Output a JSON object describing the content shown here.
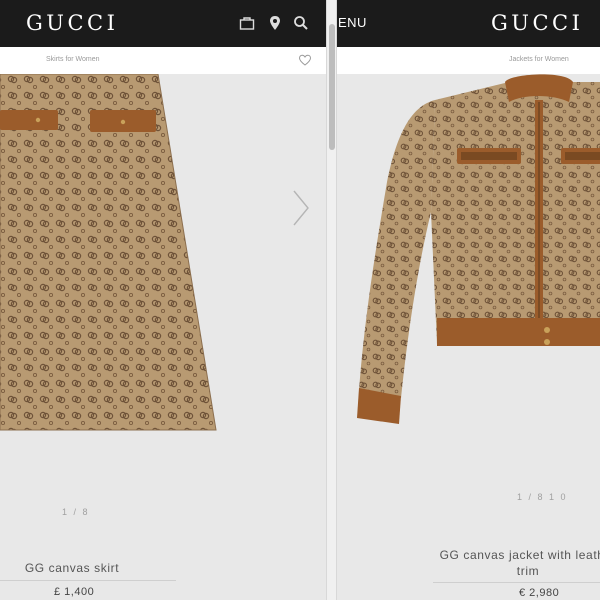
{
  "left_window": {
    "header": {
      "logo": "GUCCI",
      "icons": [
        "shopping-bag-icon",
        "location-pin-icon",
        "search-icon"
      ]
    },
    "breadcrumb": "Skirts for Women",
    "product": {
      "image": "gg-canvas-skirt-image",
      "pager": "1 / 8",
      "name": "GG canvas skirt",
      "price": "£ 1,400"
    }
  },
  "right_window": {
    "header": {
      "menu_label": "ENU",
      "logo": "GUCCI"
    },
    "breadcrumb": "Jackets for Women",
    "product": {
      "image": "gg-canvas-jacket-image",
      "pager": "1 / 8 1 0",
      "name": "GG canvas jacket with leather trim",
      "price": "€ 2,980"
    }
  },
  "colors": {
    "header_bg": "#1b1b1b",
    "page_bg": "#e8e8e8",
    "canvas_beige": "#b89a72",
    "gg_pattern": "#6e5238",
    "leather_trim": "#9b5c2b"
  }
}
